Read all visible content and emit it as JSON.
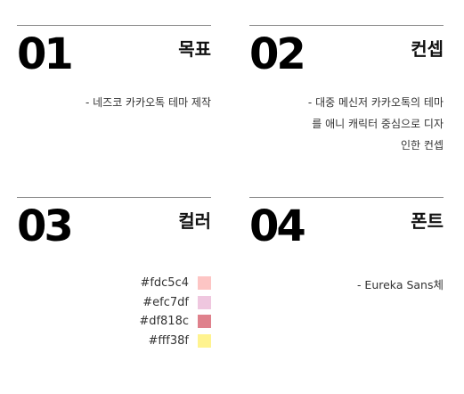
{
  "sections": [
    {
      "number": "01",
      "title": "목표",
      "lines": [
        "- 네즈코 카카오톡 테마 제작"
      ]
    },
    {
      "number": "02",
      "title": "컨셉",
      "lines": [
        "- 대중 메신저 카카오톡의 테마",
        "를 애니 캐릭터 중심으로 디자",
        "인한 컨셉"
      ]
    },
    {
      "number": "03",
      "title": "컬러",
      "colors": [
        "#fdc5c4",
        "#efc7df",
        "#df818c",
        "#fff38f"
      ]
    },
    {
      "number": "04",
      "title": "폰트",
      "lines": [
        "- Eureka Sans체"
      ]
    }
  ]
}
